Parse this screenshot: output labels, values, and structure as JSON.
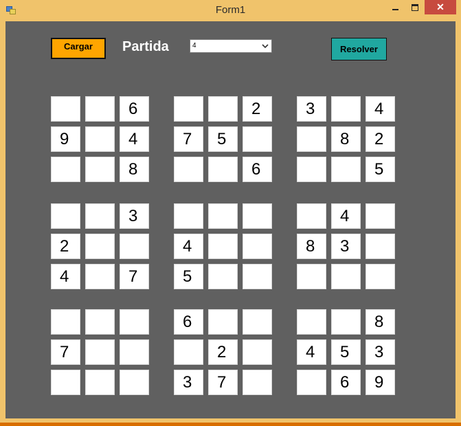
{
  "window": {
    "title": "Form1"
  },
  "toolbar": {
    "load_label": "Cargar",
    "game_label": "Partida",
    "game_selected": "4",
    "solve_label": "Resolver"
  },
  "grid": [
    [
      "",
      "",
      "6",
      "",
      "",
      "2",
      "3",
      "",
      "4"
    ],
    [
      "9",
      "",
      "4",
      "7",
      "5",
      "",
      "",
      "8",
      "2"
    ],
    [
      "",
      "",
      "8",
      "",
      "",
      "6",
      "",
      "",
      "5"
    ],
    [
      "",
      "",
      "3",
      "",
      "",
      "",
      "",
      "4",
      ""
    ],
    [
      "2",
      "",
      "",
      "4",
      "",
      "",
      "8",
      "3",
      ""
    ],
    [
      "4",
      "",
      "7",
      "5",
      "",
      "",
      "",
      "",
      ""
    ],
    [
      "",
      "",
      "",
      "6",
      "",
      "",
      "",
      "",
      "8"
    ],
    [
      "7",
      "",
      "",
      "",
      "2",
      "",
      "4",
      "5",
      "3"
    ],
    [
      "",
      "",
      "",
      "3",
      "7",
      "",
      "",
      "6",
      "9"
    ]
  ],
  "colors": {
    "titlebar": "#f0c36b",
    "client_bg": "#606060",
    "load_button": "#ffa500",
    "solve_button": "#20a8a0",
    "close_button": "#c74b3f"
  }
}
